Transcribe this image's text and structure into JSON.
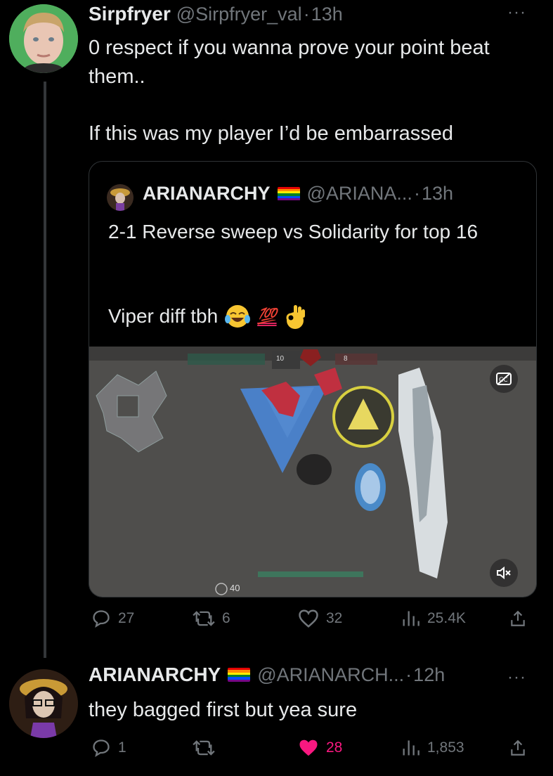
{
  "tweet1": {
    "author_name": "Sirpfryer",
    "handle": "@Sirpfryer_val",
    "separator": "·",
    "time": "13h",
    "more_label": "···",
    "text_line1": "0 respect if you wanna prove your point beat them..",
    "text_line2": "If this was my player I’d be embarrassed",
    "quote": {
      "author_name": "ARIANARCHY",
      "handle": "@ARIANA...",
      "separator": "·",
      "time": "13h",
      "text_line1": "2-1 Reverse sweep vs Solidarity for top 16",
      "text_line2": "Viper diff tbh",
      "emoji_100": "💯",
      "hud_ammo": "40",
      "hud_score_left": "10",
      "hud_score_right": "8"
    },
    "replies": "27",
    "reposts": "6",
    "likes": "32",
    "views": "25.4K"
  },
  "tweet2": {
    "author_name": "ARIANARCHY",
    "handle": "@ARIANARCH...",
    "separator": "·",
    "time": "12h",
    "more_label": "···",
    "text": "they bagged first but yea sure",
    "replies": "1",
    "reposts": "",
    "likes": "28",
    "views": "1,853"
  },
  "colors": {
    "background": "#000000",
    "text": "#e7e9ea",
    "muted": "#71767b",
    "like_active": "#f91880",
    "border": "#2f3336"
  },
  "icons": [
    "reply-icon",
    "repost-icon",
    "like-icon",
    "views-icon",
    "share-icon",
    "more-icon",
    "mute-icon",
    "captions-icon",
    "pride-flag-icon"
  ]
}
